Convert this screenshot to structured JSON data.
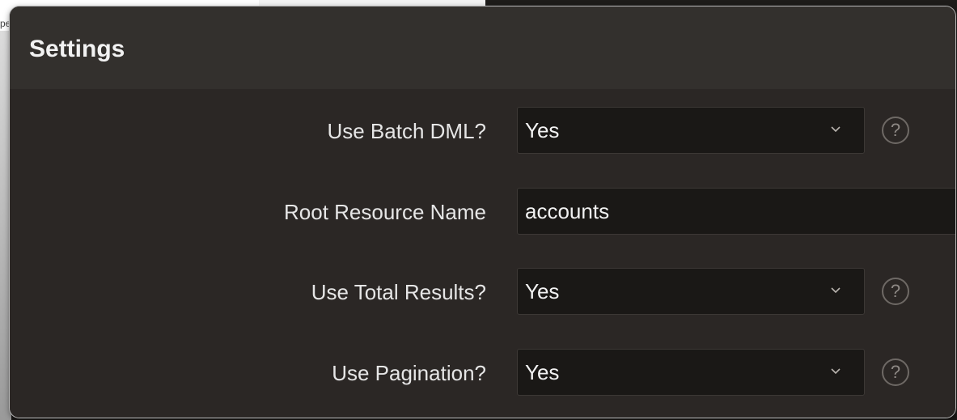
{
  "background": {
    "left_text": "pe"
  },
  "panel": {
    "title": "Settings",
    "rows": [
      {
        "label": "Use Batch DML?",
        "value": "Yes",
        "type": "select",
        "help": "?"
      },
      {
        "label": "Root Resource Name",
        "value": "accounts",
        "type": "text"
      },
      {
        "label": "Use Total Results?",
        "value": "Yes",
        "type": "select",
        "help": "?"
      },
      {
        "label": "Use Pagination?",
        "value": "Yes",
        "type": "select",
        "help": "?"
      }
    ]
  },
  "icons": {
    "chevron": "chevron-down-icon",
    "help": "help-icon"
  },
  "colors": {
    "panel_bg": "#2b2725",
    "header_bg": "#33302d",
    "field_bg": "#1a1816",
    "text": "#f2f2f2",
    "help_outline": "#6e6965"
  }
}
